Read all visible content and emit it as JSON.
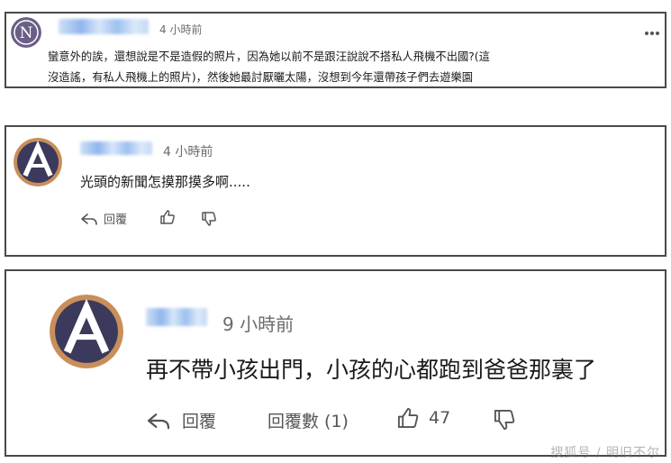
{
  "comments": [
    {
      "avatar_letter": "N",
      "time": "4 小時前",
      "lines": [
        "蠻意外的誒，還想說是不是造假的照片，因為她以前不是跟汪說說不搭私人飛機不出國?(這",
        "沒造謠，有私人飛機上的照片)，然後她最討厭曬太陽，沒想到今年還帶孩子們去遊樂園"
      ]
    },
    {
      "avatar_letter": "A",
      "time": "4 小時前",
      "text": "光頭的新聞怎摸那摸多啊.....",
      "reply_label": "回覆"
    },
    {
      "avatar_letter": "A",
      "time": "9 小時前",
      "text": "再不帶小孩出門，小孩的心都跑到爸爸那裏了",
      "reply_label": "回覆",
      "replies_count_label": "回覆數 (1)",
      "like_count": "47"
    }
  ],
  "watermark": "搜狐号 / 明旧不尔",
  "icons": {
    "more": "more-icon",
    "reply": "reply-icon",
    "like": "thumbs-up-icon",
    "dislike": "thumbs-down-icon"
  },
  "colors": {
    "card_border": "#4a4a4a",
    "avatar_n_bg": "#6b5f86",
    "avatar_a_bg": "#3b3a5c",
    "avatar_a_ring": "#c88f5a"
  }
}
